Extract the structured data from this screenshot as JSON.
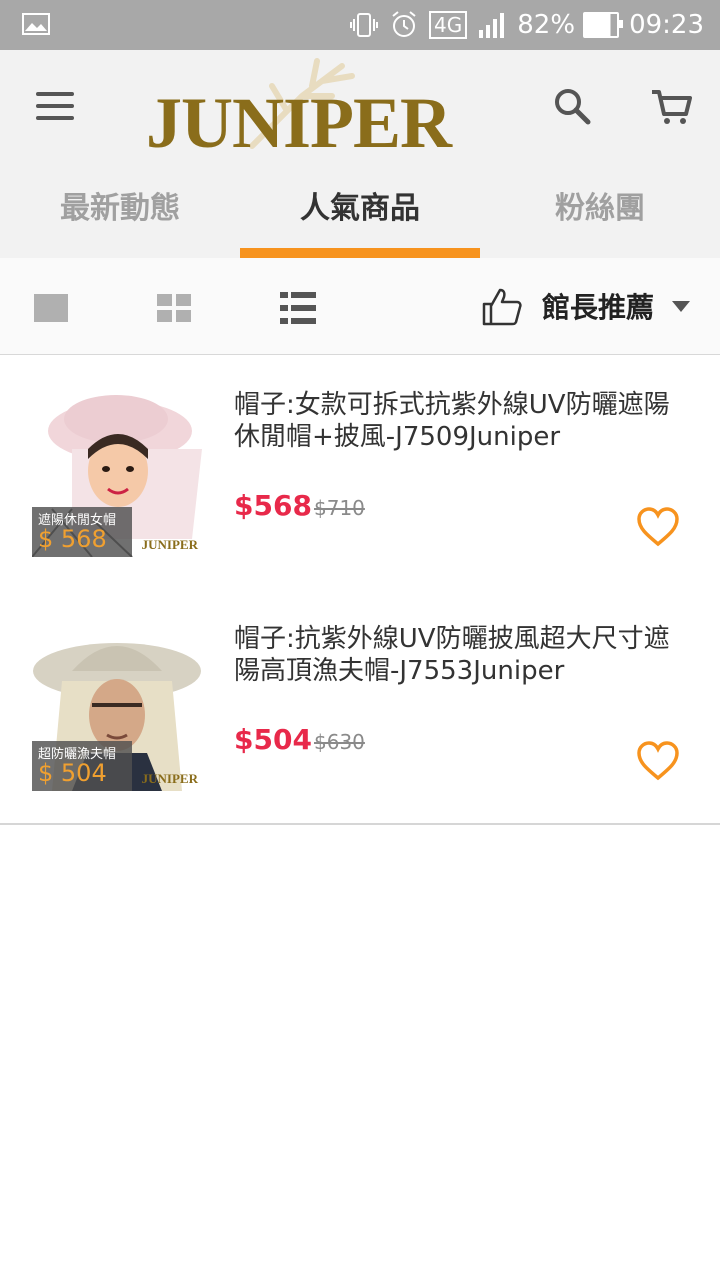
{
  "status_bar": {
    "network": "4G",
    "battery": "82%",
    "time": "09:23"
  },
  "header": {
    "logo_text": "JUNIPER",
    "brand_color": "#8a6d1b"
  },
  "tabs": [
    {
      "label": "最新動態",
      "active": false
    },
    {
      "label": "人氣商品",
      "active": true
    },
    {
      "label": "粉絲團",
      "active": false
    }
  ],
  "toolbar": {
    "sort_label": "館長推薦"
  },
  "products": [
    {
      "title": "帽子:女款可拆式抗紫外線UV防曬遮陽休閒帽+披風-J7509Juniper",
      "price": "$568",
      "original_price": "$710",
      "thumb_badge_name": "遮陽休閒女帽",
      "thumb_badge_price": "$ 568",
      "thumb_brand": "JUNIPER"
    },
    {
      "title": "帽子:抗紫外線UV防曬披風超大尺寸遮陽高頂漁夫帽-J7553Juniper",
      "price": "$504",
      "original_price": "$630",
      "thumb_badge_name": "超防曬漁夫帽",
      "thumb_badge_price": "$ 504",
      "thumb_brand": "JUNIPER"
    }
  ],
  "colors": {
    "accent": "#f7931e",
    "price": "#e8294a"
  }
}
